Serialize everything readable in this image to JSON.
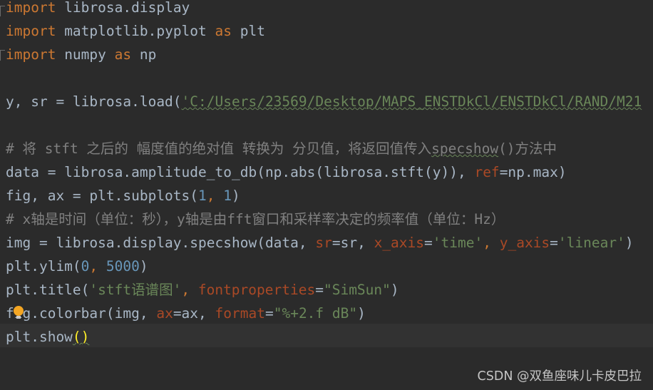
{
  "editor": {
    "lines": [
      {
        "segments": [
          {
            "t": "import",
            "c": "kw"
          },
          {
            "t": " librosa.display",
            "c": "plain"
          }
        ]
      },
      {
        "segments": [
          {
            "t": "import",
            "c": "kw"
          },
          {
            "t": " matplotlib.pyplot ",
            "c": "plain"
          },
          {
            "t": "as",
            "c": "kw"
          },
          {
            "t": " plt",
            "c": "plain"
          }
        ]
      },
      {
        "segments": [
          {
            "t": "import",
            "c": "kw"
          },
          {
            "t": " numpy ",
            "c": "plain"
          },
          {
            "t": "as",
            "c": "kw"
          },
          {
            "t": " np",
            "c": "plain"
          }
        ]
      },
      {
        "segments": []
      },
      {
        "segments": [
          {
            "t": "y, sr = librosa.load(",
            "c": "plain"
          },
          {
            "t": "'C:/Users/23569/Desktop/MAPS_ENSTDkCl/ENSTDkCl/RAND/M21",
            "c": "str squig"
          }
        ]
      },
      {
        "segments": []
      },
      {
        "segments": [
          {
            "t": "# 将 stft 之后的 幅度值的绝对值 转换为 分贝值，将返回值传入",
            "c": "cm"
          },
          {
            "t": "specshow",
            "c": "cm squig"
          },
          {
            "t": "()方法中",
            "c": "cm"
          }
        ]
      },
      {
        "segments": [
          {
            "t": "data = librosa.amplitude_to_db(np.abs(librosa.stft(y)), ",
            "c": "plain"
          },
          {
            "t": "ref",
            "c": "pn"
          },
          {
            "t": "=np.max)",
            "c": "plain"
          }
        ]
      },
      {
        "segments": [
          {
            "t": "fig, ax = plt.subplots(",
            "c": "plain"
          },
          {
            "t": "1",
            "c": "num"
          },
          {
            "t": ", ",
            "c": "kw"
          },
          {
            "t": "1",
            "c": "num"
          },
          {
            "t": ")",
            "c": "plain"
          }
        ]
      },
      {
        "segments": [
          {
            "t": "# x轴是时间（单位：秒），y轴是由fft窗口和采样率决定的频率值（单位：Hz）",
            "c": "cm"
          }
        ]
      },
      {
        "segments": [
          {
            "t": "img = librosa.display.specshow(data, ",
            "c": "plain"
          },
          {
            "t": "sr",
            "c": "pn"
          },
          {
            "t": "=sr, ",
            "c": "plain"
          },
          {
            "t": "x_axis",
            "c": "pn"
          },
          {
            "t": "=",
            "c": "plain"
          },
          {
            "t": "'time'",
            "c": "str"
          },
          {
            "t": ", ",
            "c": "kw"
          },
          {
            "t": "y_axis",
            "c": "pn"
          },
          {
            "t": "=",
            "c": "plain"
          },
          {
            "t": "'linear'",
            "c": "str"
          },
          {
            "t": ")",
            "c": "plain"
          }
        ]
      },
      {
        "segments": [
          {
            "t": "plt.ylim(",
            "c": "plain"
          },
          {
            "t": "0",
            "c": "num"
          },
          {
            "t": ", ",
            "c": "kw"
          },
          {
            "t": "5000",
            "c": "num"
          },
          {
            "t": ")",
            "c": "plain"
          }
        ]
      },
      {
        "segments": [
          {
            "t": "plt.title(",
            "c": "plain"
          },
          {
            "t": "'stft语谱图'",
            "c": "str"
          },
          {
            "t": ", ",
            "c": "kw"
          },
          {
            "t": "fontproperties",
            "c": "pn"
          },
          {
            "t": "=",
            "c": "plain"
          },
          {
            "t": "\"SimSun\"",
            "c": "str"
          },
          {
            "t": ")",
            "c": "plain"
          }
        ]
      },
      {
        "segments": [
          {
            "t": "fig.colorbar(img, ",
            "c": "plain"
          },
          {
            "t": "ax",
            "c": "pn"
          },
          {
            "t": "=ax, ",
            "c": "plain"
          },
          {
            "t": "format",
            "c": "pn"
          },
          {
            "t": "=",
            "c": "plain"
          },
          {
            "t": "\"%+2.f dB\"",
            "c": "str"
          },
          {
            "t": ")",
            "c": "plain"
          }
        ]
      },
      {
        "segments": [
          {
            "t": "plt.show",
            "c": "plain"
          },
          {
            "t": "()",
            "c": "paren squig"
          }
        ]
      }
    ]
  },
  "watermark": {
    "text": "CSDN @双鱼座味儿卡皮巴拉"
  },
  "colors": {
    "background": "#2b2b2b",
    "keyword": "#cc7832",
    "string": "#6a8759",
    "number": "#6897bb",
    "comment": "#808080",
    "param": "#aa4926",
    "default": "#a9b7c6"
  }
}
